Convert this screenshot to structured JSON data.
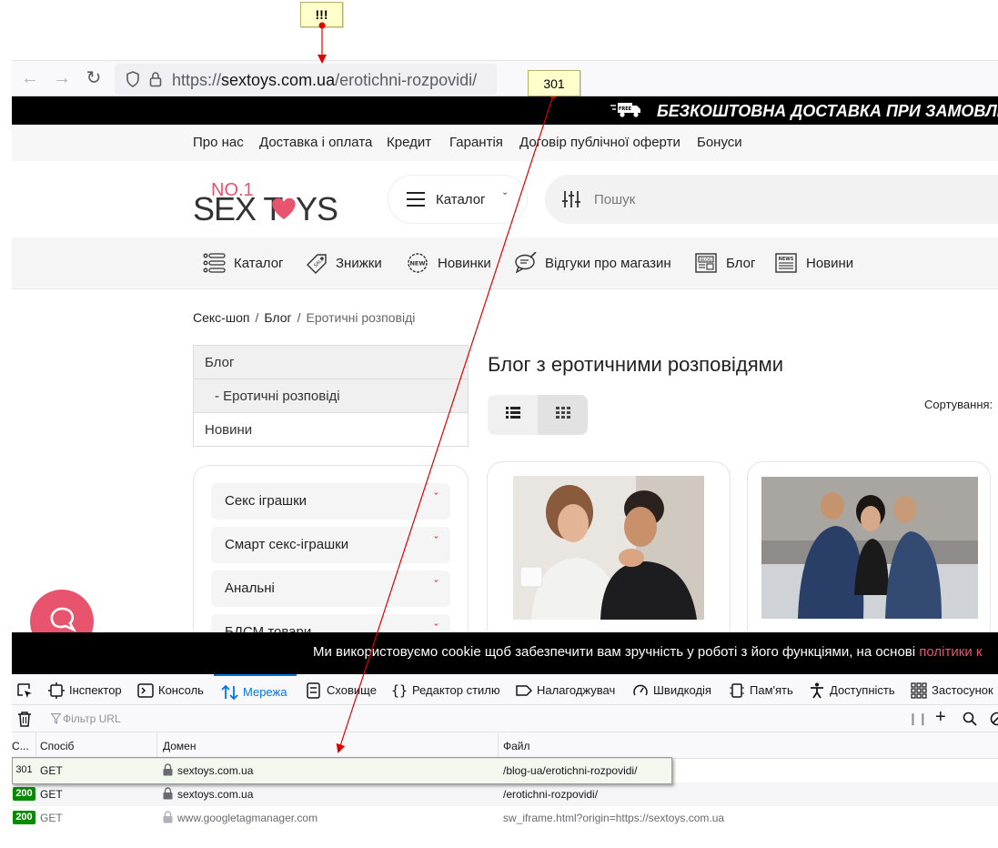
{
  "annotations": {
    "top_label": "!!!",
    "redirect_label": "301"
  },
  "browser": {
    "url_prefix": "https://",
    "url_domain": "sextoys.com.ua",
    "url_path": "/erotichni-rozpovidi/"
  },
  "promo": {
    "text": "БЕЗКОШТОВНА ДОСТАВКА ПРИ ЗАМОВЛЕННІ",
    "truck_badge": "FREE"
  },
  "info_nav": [
    "Про нас",
    "Доставка і оплата",
    "Кредит",
    "Гарантія",
    "Договір публічної оферти",
    "Бонуси"
  ],
  "logo": {
    "top": "NO.1",
    "left": "SEX T",
    "right": "YS"
  },
  "header": {
    "catalog_label": "Каталог",
    "search_placeholder": "Пошук"
  },
  "menu": [
    {
      "label": "Каталог",
      "icon": "list-icon"
    },
    {
      "label": "Знижки",
      "icon": "sale-tag-icon"
    },
    {
      "label": "Новинки",
      "icon": "new-badge-icon"
    },
    {
      "label": "Відгуки про магазин",
      "icon": "reviews-icon"
    },
    {
      "label": "Блог",
      "icon": "blog-icon"
    },
    {
      "label": "Новини",
      "icon": "news-icon"
    }
  ],
  "breadcrumb": [
    "Секс-шоп",
    "Блог",
    "Еротичні розповіді"
  ],
  "blog_menu": [
    "Блог",
    "- Еротичні розповіді",
    "Новини"
  ],
  "categories": [
    "Секс іграшки",
    "Смарт секс-іграшки",
    "Анальні",
    "БДСМ товари"
  ],
  "content": {
    "title": "Блог з еротичними розповідями",
    "sort_label": "Сортування:"
  },
  "cookie": {
    "text": "Ми використовуємо cookie щоб забезпечити вам зручність у роботі з його функціями, на основі ",
    "link": "політики к"
  },
  "devtools": {
    "tabs": [
      "Інспектор",
      "Консоль",
      "Мережа",
      "Сховище",
      "Редактор стилю",
      "Налагоджувач",
      "Швидкодія",
      "Пам'ять",
      "Доступність",
      "Застосунок"
    ],
    "active_tab": "Мережа",
    "filter_placeholder": "Фільтр URL",
    "columns": [
      "С...",
      "Спосіб",
      "Домен",
      "Файл"
    ],
    "rows": [
      {
        "status": "301",
        "method": "GET",
        "domain": "sextoys.com.ua",
        "file": "/blog-ua/erotichni-rozpovidi/"
      },
      {
        "status": "200",
        "method": "GET",
        "domain": "sextoys.com.ua",
        "file": "/erotichni-rozpovidi/"
      },
      {
        "status": "200",
        "method": "GET",
        "domain": "www.googletagmanager.com",
        "file": "sw_iframe.html?origin=https://sextoys.com.ua"
      }
    ]
  },
  "colors": {
    "accent": "#e8546e",
    "devtools_active": "#0074e8",
    "status_ok": "#058b00",
    "arrow": "#e00000"
  }
}
